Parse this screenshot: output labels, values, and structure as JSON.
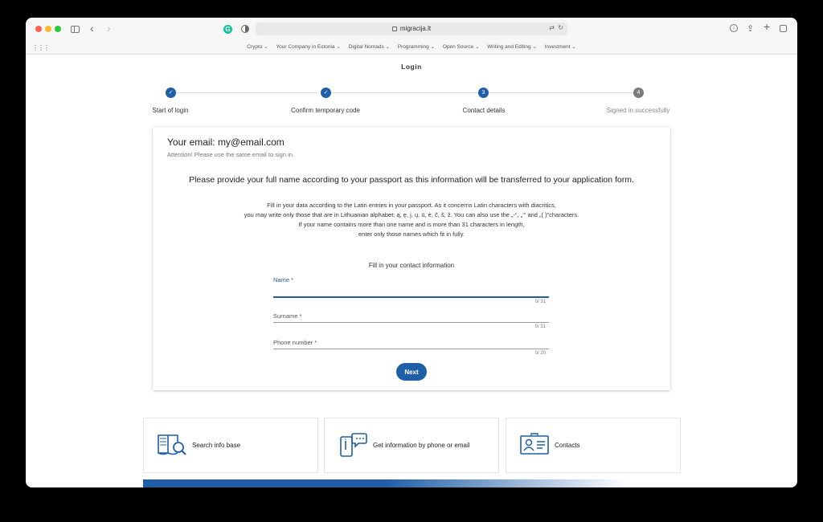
{
  "browser": {
    "url": "migracija.lt",
    "bookmarks": [
      "Crypto ⌄",
      "Your Company in Estonia ⌄",
      "Digital Nomads ⌄",
      "Programming ⌄",
      "Open Source ⌄",
      "Writing and Editing ⌄",
      "Investment ⌄"
    ]
  },
  "page": {
    "title": "Login"
  },
  "stepper": {
    "steps": [
      {
        "label": "Start of login",
        "state": "done",
        "marker": "✓"
      },
      {
        "label": "Confirm temporary code",
        "state": "done",
        "marker": "✓"
      },
      {
        "label": "Contact details",
        "state": "active",
        "marker": "3"
      },
      {
        "label": "Signed in successfully",
        "state": "todo",
        "marker": "4"
      }
    ]
  },
  "card": {
    "email_label": "Your email:",
    "email_value": "my@email.com",
    "attention": "Attention! Please use the same email to sign in.",
    "passport_heading": "Please provide your full name according to your passport as this information will be transferred to your application form.",
    "instructions": [
      "Fill in your data according to the Latin entries in your passport. As it concerns Latin characters with diacritics,",
      "you may write only those that are in Lithuanian alphabet: ą, ę, į, ų, ū, ė, č, š, ž. You can also use the „-“, „‘“ and „( )“characters.",
      "If your name contains more than one name and is more than 31 characters in length,",
      "enter only those names which fit in fully."
    ],
    "form_heading": "Fill in your contact information",
    "fields": {
      "name": {
        "label": "Name *",
        "value": "",
        "counter": "0/ 31"
      },
      "surname": {
        "label": "Surname *",
        "value": "",
        "counter": "0/ 31"
      },
      "phone": {
        "label": "Phone number *",
        "value": "",
        "counter": "0/ 20"
      }
    },
    "next_label": "Next"
  },
  "info_cards": [
    {
      "label": "Search info base",
      "icon": "book-search-icon"
    },
    {
      "label": "Get information by phone or email",
      "icon": "phone-chat-icon"
    },
    {
      "label": "Contacts",
      "icon": "contact-card-icon"
    }
  ],
  "colors": {
    "accent": "#1f5fa8",
    "step_todo": "#7a7a7a"
  }
}
